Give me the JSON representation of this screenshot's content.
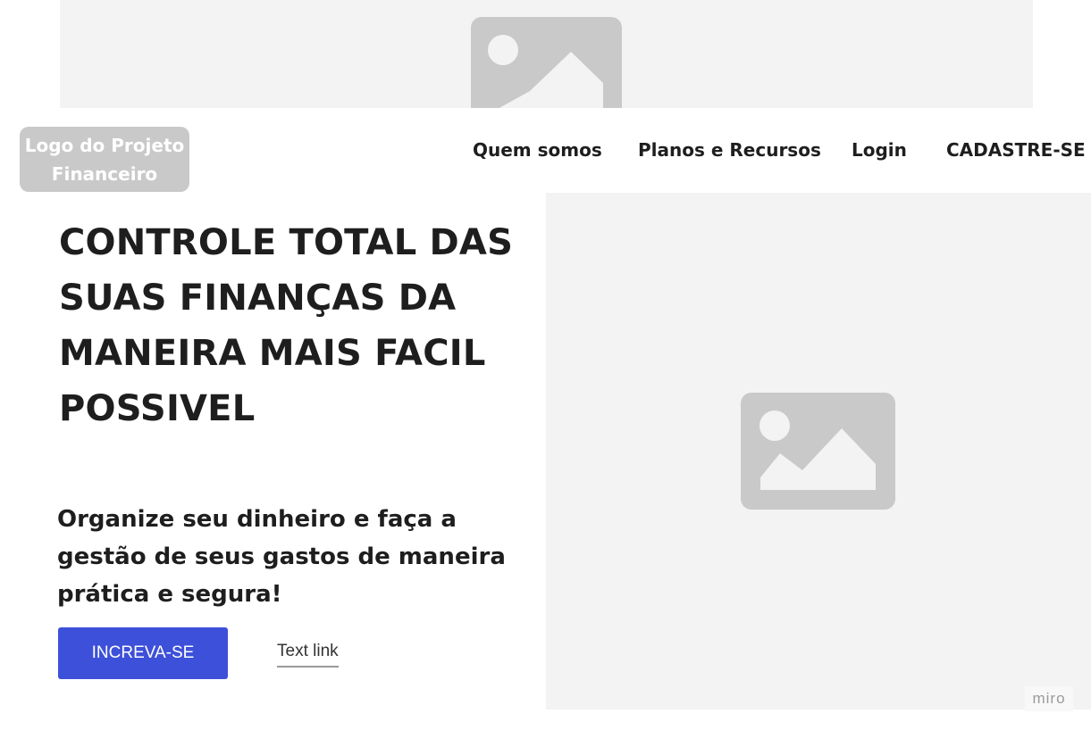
{
  "header": {
    "logo_text": "Logo do Projeto\nFinanceiro",
    "nav": [
      {
        "label": "Quem somos"
      },
      {
        "label": "Planos e Recursos"
      },
      {
        "label": "Login"
      },
      {
        "label": "CADASTRE-SE"
      }
    ]
  },
  "hero": {
    "title": "CONTROLE TOTAL DAS SUAS FINANÇAS DA MANEIRA MAIS FACIL POSSIVEL",
    "subtitle": "Organize seu dinheiro e faça a gestão de seus gastos de maneira prática e segura!",
    "cta_label": "INCREVA-SE",
    "link_label": "Text link",
    "image_icon": "image-placeholder-icon"
  },
  "banner": {
    "image_icon": "image-placeholder-icon"
  },
  "watermark": {
    "label": "miro"
  },
  "colors": {
    "placeholder_bg": "#f3f3f3",
    "placeholder_icon": "#c9c9c9",
    "logo_bg": "#c9c9c9",
    "cta_bg": "#3d50d9",
    "text": "#1e1e1e"
  }
}
